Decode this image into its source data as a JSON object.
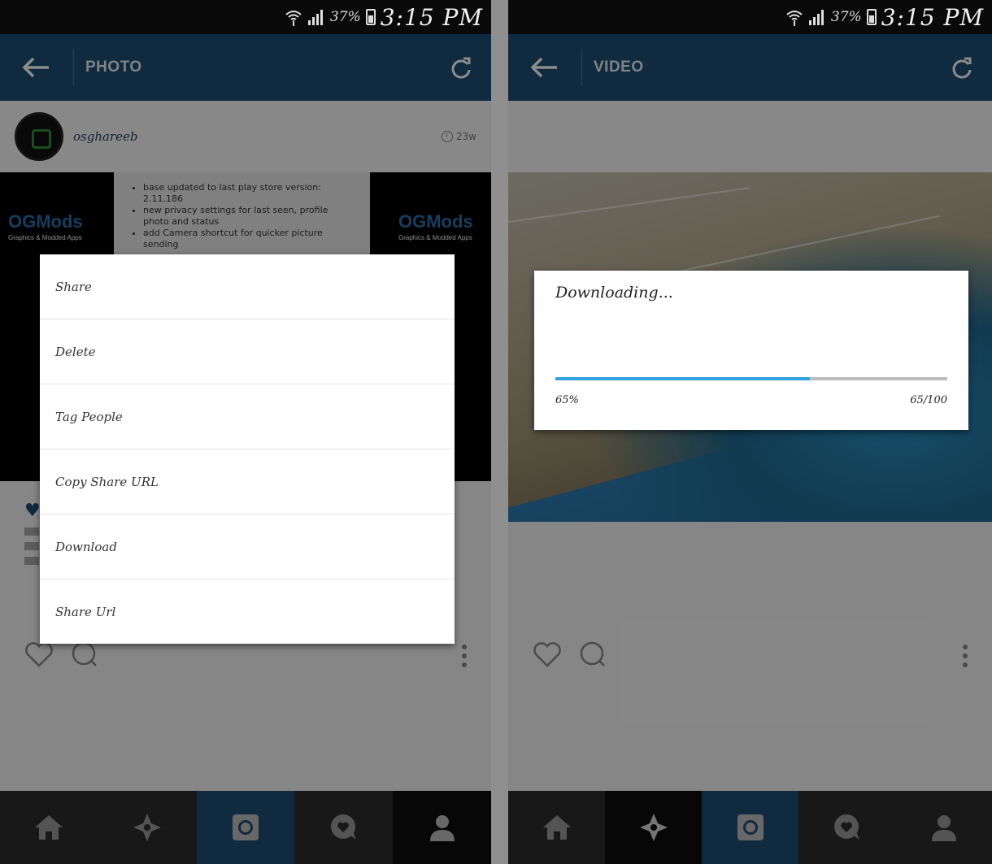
{
  "status_bar": {
    "battery": "37%",
    "time": "3:15 PM"
  },
  "left_screen": {
    "title": "PHOTO",
    "post": {
      "username": "osghareeb",
      "time": "23w",
      "logo_text": "OGMods",
      "logo_sub": "Graphics & Modded Apps",
      "notes": [
        "base updated to last play store version: 2.11.186",
        "new privacy settings for last seen, profile photo and status",
        "add Camera shortcut for quicker picture sending"
      ]
    },
    "menu": {
      "items": [
        "Share",
        "Delete",
        "Tag People",
        "Copy Share URL",
        "Download",
        "Share Url"
      ]
    }
  },
  "right_screen": {
    "title": "VIDEO",
    "download_dialog": {
      "title": "Downloading...",
      "progress_fraction": 0.65,
      "percent_label": "65%",
      "count_label": "65/100"
    }
  },
  "bottom_nav": {
    "icons": [
      "home-icon",
      "explore-icon",
      "camera-icon",
      "activity-icon",
      "profile-icon"
    ]
  },
  "colors": {
    "top_bar": "#1e4d74",
    "status_bar": "#0a0a0a",
    "progress_fill": "#33a2dc",
    "nav_bg": "#2c2c2c"
  }
}
